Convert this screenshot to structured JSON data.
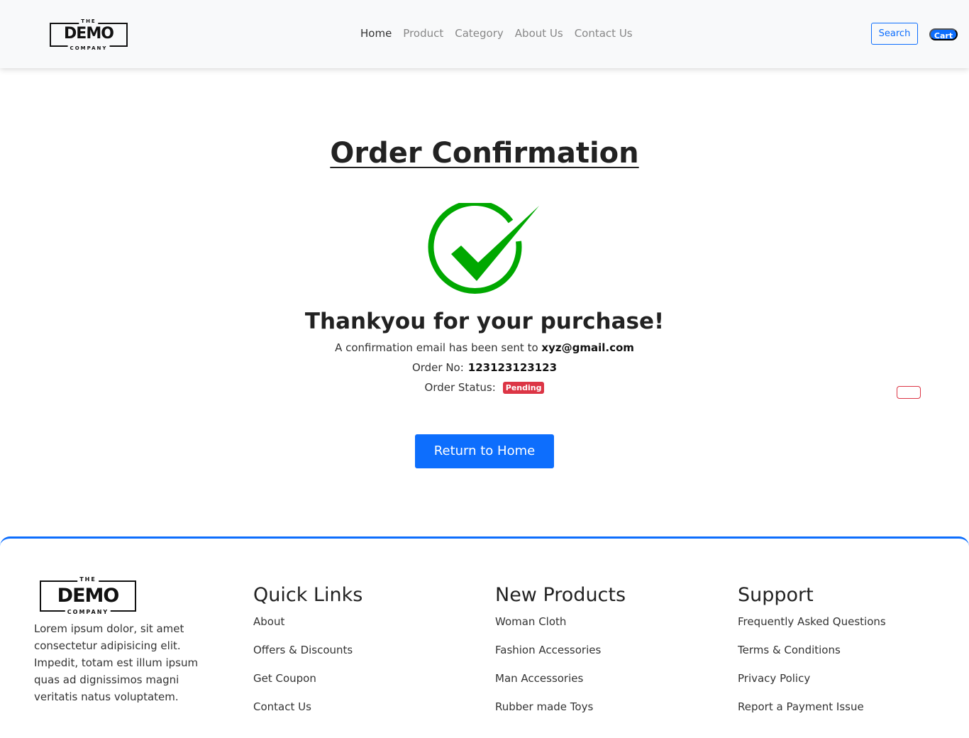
{
  "header": {
    "logo": {
      "top": "THE",
      "main": "DEMO",
      "bottom": "COMPANY"
    },
    "nav": [
      {
        "label": "Home",
        "active": true
      },
      {
        "label": "Product",
        "active": false
      },
      {
        "label": "Category",
        "active": false
      },
      {
        "label": "About Us",
        "active": false
      },
      {
        "label": "Contact Us",
        "active": false
      }
    ],
    "search_label": "Search",
    "cart_label": "Cart"
  },
  "main": {
    "title": "Order Confirmation",
    "icon": "check-circle-icon",
    "thanks": "Thankyou for your purchase!",
    "email_text": "A confirmation email has been sent to",
    "email": "xyz@gmail.com",
    "order_no_label": "Order No:",
    "order_no": "123123123123",
    "order_status_label": "Order Status:",
    "order_status": "Pending",
    "return_label": "Return to Home"
  },
  "footer": {
    "logo": {
      "top": "THE",
      "main": "DEMO",
      "bottom": "COMPANY"
    },
    "about": "Lorem ipsum dolor, sit amet consectetur adipisicing elit. Impedit, totam est illum ipsum quas ad dignissimos magni veritatis natus voluptatem.",
    "columns": [
      {
        "title": "Quick Links",
        "links": [
          "About",
          "Offers & Discounts",
          "Get Coupon",
          "Contact Us"
        ]
      },
      {
        "title": "New Products",
        "links": [
          "Woman Cloth",
          "Fashion Accessories",
          "Man Accessories",
          "Rubber made Toys"
        ]
      },
      {
        "title": "Support",
        "links": [
          "Frequently Asked Questions",
          "Terms & Conditions",
          "Privacy Policy",
          "Report a Payment Issue"
        ]
      }
    ]
  },
  "colors": {
    "primary": "#0d6efd",
    "success": "#00a800",
    "danger": "#dc3545"
  }
}
